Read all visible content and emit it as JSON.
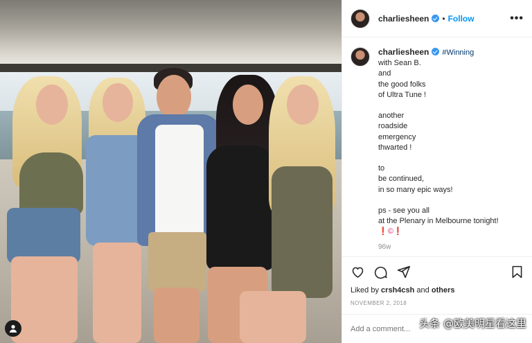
{
  "post": {
    "username": "charliesheen",
    "follow_label": "Follow",
    "more_label": "•••",
    "dot": "•"
  },
  "caption": {
    "username": "charliesheen",
    "hashtag": "#Winning",
    "lines_a": [
      "with Sean B.",
      "and",
      "the good folks",
      "of Ultra Tune !"
    ],
    "lines_b": [
      "another",
      "roadside",
      "emergency",
      "thwarted !"
    ],
    "lines_c": [
      "to",
      "be continued,",
      "in so many epic ways!"
    ],
    "lines_d": [
      "ps - see you all",
      "at the Plenary in Melbourne tonight!"
    ],
    "emoji_line": [
      "❗",
      "©",
      "❗"
    ],
    "time_ago": "96w"
  },
  "engagement": {
    "liked_prefix": "Liked by",
    "liked_user": "crsh4csh",
    "liked_and": "and",
    "liked_others": "others",
    "date": "NOVEMBER 2, 2018"
  },
  "comment": {
    "placeholder": "Add a comment..."
  },
  "overlay": {
    "watermark": "头条 @欧美明星看这里"
  },
  "icons": [
    "verified-icon",
    "more-icon",
    "heart-icon",
    "comment-icon",
    "share-icon",
    "bookmark-icon",
    "user-tag-icon"
  ],
  "colors": {
    "accent": "#0095f6",
    "verified": "#3897f0",
    "hashtag": "#00376b",
    "muted": "#8e8e8e"
  }
}
